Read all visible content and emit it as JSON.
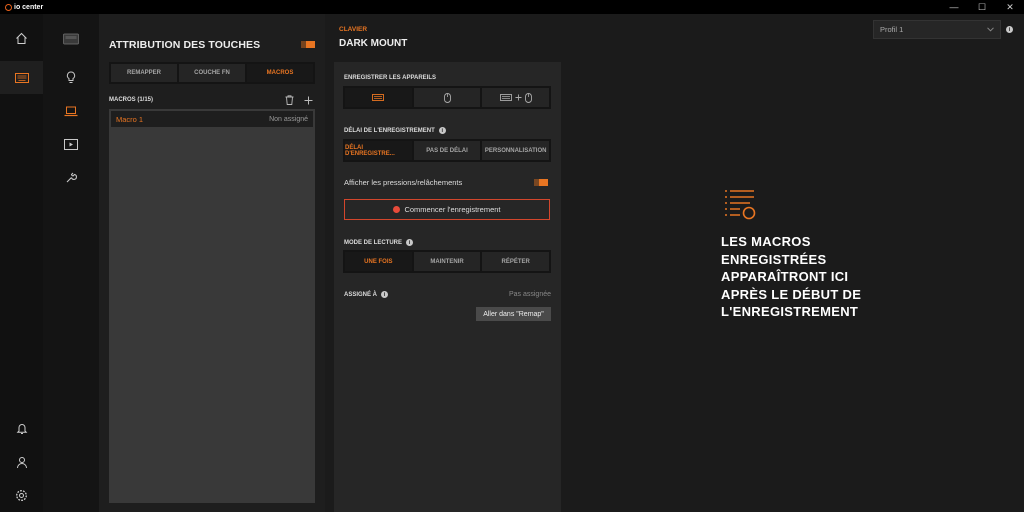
{
  "app": {
    "title": "io center"
  },
  "window_controls": {
    "minimize": "—",
    "maximize": "☐",
    "close": "✕"
  },
  "rail": {
    "items": [
      "home-icon",
      "keyboard-icon"
    ],
    "bottom": [
      "bell-icon",
      "user-icon",
      "gear-icon"
    ]
  },
  "nav2": {
    "items": [
      "device-icon",
      "bulb-icon",
      "laptop-icon",
      "display-icon",
      "wrench-icon"
    ]
  },
  "left": {
    "title": "ATTRIBUTION DES TOUCHES",
    "tabs": [
      "REMAPPER",
      "COUCHE FN",
      "MACROS"
    ],
    "macros_header": "MACROS (1/15)",
    "list": [
      {
        "name": "Macro 1",
        "value": "Non assigné"
      }
    ]
  },
  "mid": {
    "category": "CLAVIER",
    "device": "DARK MOUNT",
    "record_devices_label": "ENREGISTRER LES APPAREILS",
    "delay_label": "DÉLAI DE L'ENREGISTREMENT",
    "delay_tabs": [
      "DÉLAI D'ENREGISTRE...",
      "PAS DE DÉLAI",
      "PERSONNALISATION"
    ],
    "show_presses_label": "Afficher les pressions/relâchements",
    "record_button": "Commencer l'enregistrement",
    "playback_label": "MODE DE LECTURE",
    "playback_tabs": [
      "UNE FOIS",
      "MAINTENIR",
      "RÉPÉTER"
    ],
    "assigned_label": "ASSIGNÉ À",
    "assigned_value": "Pas assignée",
    "goto_button": "Aller dans \"Remap\""
  },
  "right": {
    "profile": "Profil 1",
    "empty_message": "LES MACROS ENREGISTRÉES APPARAÎTRONT ICI APRÈS LE DÉBUT DE L'ENREGISTREMENT"
  },
  "colors": {
    "accent": "#e87522",
    "record": "#e84b3a"
  }
}
